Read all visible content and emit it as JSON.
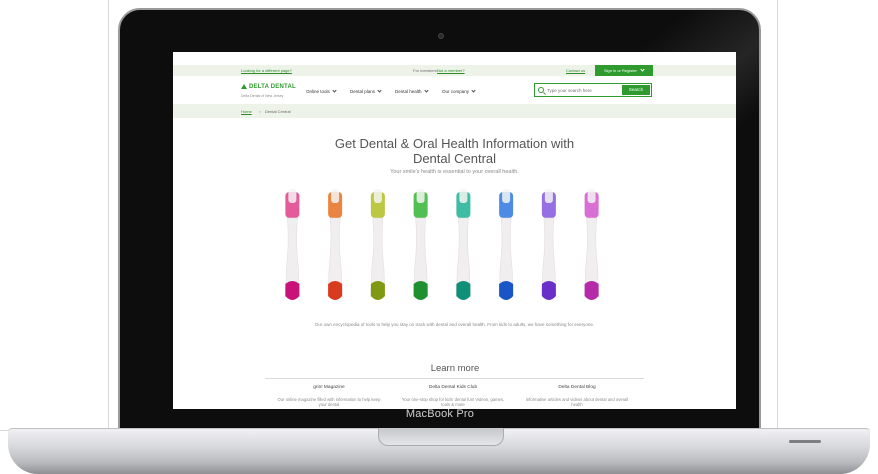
{
  "device": {
    "label": "MacBook Pro"
  },
  "utility_bar": {
    "wrong_page_link": "Looking for a different page?",
    "members_text": "For members:",
    "members_link": "Not a member?",
    "contact_link": "Contact us",
    "signin_label": "Sign in or Register"
  },
  "header": {
    "logo_text": "DELTA DENTAL",
    "logo_subtext": "Delta Dental of New Jersey",
    "nav_items": [
      "Online tools",
      "Dental plans",
      "Dental health",
      "Our company"
    ],
    "search_placeholder": "Type your search here",
    "search_button": "Search"
  },
  "breadcrumb": {
    "home": "Home",
    "separator": ">",
    "current": "Dental Central"
  },
  "hero": {
    "title_line1": "Get Dental & Oral Health Information with",
    "title_line2": "Dental Central",
    "subtitle": "Your smile's health is essential to your overall health."
  },
  "toothbrushes": {
    "colors": [
      "#e0498f",
      "#e8772e",
      "#b5c230",
      "#3fb83f",
      "#2ab59a",
      "#3b7fe0",
      "#8a5fe0",
      "#d35fd0"
    ],
    "handle_bases": [
      "#c8127a",
      "#d83a1e",
      "#7f9a12",
      "#1f8f2f",
      "#0e8f78",
      "#1a55c8",
      "#6a2fc8",
      "#b52aa8"
    ]
  },
  "body_text": "Our own encyclopedia of tools to help you stay on track with dental and overall health. From kids to adults, we have something for everyone.",
  "learn_more": {
    "heading": "Learn more",
    "cards": [
      {
        "title": "grin! Magazine",
        "text": "Our online magazine filled with information to help keep your dental"
      },
      {
        "title": "Delta Dental Kids Club",
        "text": "Your one-stop shop for kids' dental fun! Videos, games, tools & more"
      },
      {
        "title": "Delta Dental Blog",
        "text": "Informative articles and videos about dental and overall health"
      }
    ]
  }
}
